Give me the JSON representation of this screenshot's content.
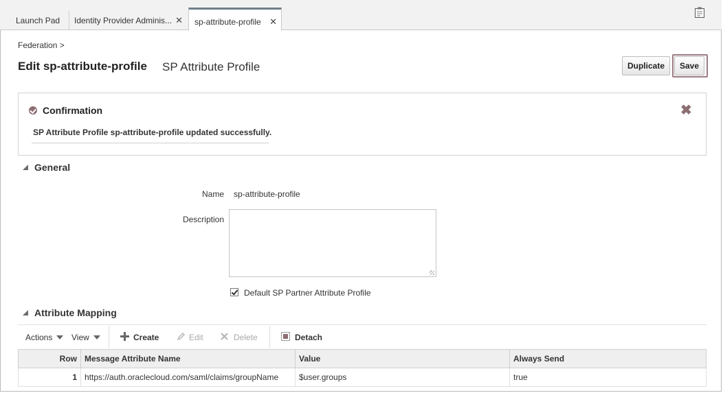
{
  "tabs": [
    {
      "label": "Launch Pad",
      "closable": false
    },
    {
      "label": "Identity Provider Adminis...",
      "closable": true
    },
    {
      "label": "sp-attribute-profile",
      "closable": true,
      "active": true
    }
  ],
  "close_glyph": "✕",
  "breadcrumb": "Federation >",
  "page": {
    "title": "Edit sp-attribute-profile",
    "subtitle": "SP Attribute Profile"
  },
  "buttons": {
    "duplicate": "Duplicate",
    "save": "Save"
  },
  "confirmation": {
    "heading": "Confirmation",
    "message": "SP Attribute Profile sp-attribute-profile updated successfully.",
    "close": "✖"
  },
  "general": {
    "heading": "General",
    "name_label": "Name",
    "name_value": "sp-attribute-profile",
    "description_label": "Description",
    "description_value": "",
    "default_checkbox_label": "Default SP Partner Attribute Profile",
    "default_checked": true
  },
  "attribute_mapping": {
    "heading": "Attribute Mapping",
    "toolbar": {
      "actions": "Actions",
      "view": "View",
      "create": "Create",
      "edit": "Edit",
      "delete": "Delete",
      "detach": "Detach"
    },
    "columns": [
      "Row",
      "Message Attribute Name",
      "Value",
      "Always Send"
    ],
    "rows": [
      {
        "row": "1",
        "name": "https://auth.oraclecloud.com/saml/claims/groupName",
        "value": "$user.groups",
        "always_send": "true"
      }
    ]
  },
  "colors": {
    "accent": "#8c6e73",
    "tab_active_border": "#6f7f8c",
    "header_bg": "#efefef"
  }
}
